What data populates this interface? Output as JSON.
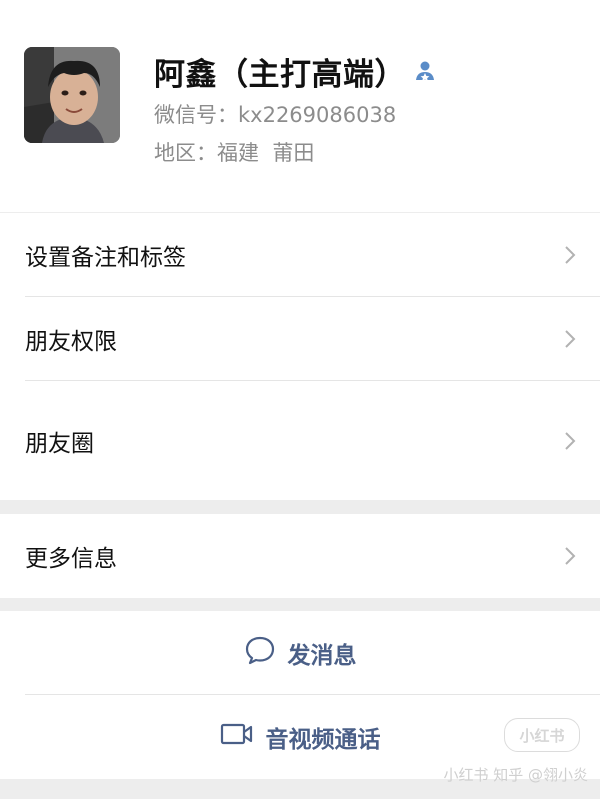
{
  "profile": {
    "name": "阿鑫（主打高端）",
    "wechat_id_label": "微信号：",
    "wechat_id": "kx2269086038",
    "region_label": "地区：",
    "region": "福建  莆田",
    "badge_icon": "user-star-icon",
    "accent_color": "#5a8cc8"
  },
  "menu_primary": [
    {
      "label": "设置备注和标签",
      "icon": "chevron-right-icon"
    },
    {
      "label": "朋友权限",
      "icon": "chevron-right-icon"
    },
    {
      "label": "朋友圈",
      "icon": "chevron-right-icon"
    }
  ],
  "menu_secondary": [
    {
      "label": "更多信息",
      "icon": "chevron-right-icon"
    }
  ],
  "actions": {
    "send_message": {
      "label": "发消息",
      "icon": "chat-bubble-icon"
    },
    "video_call": {
      "label": "音视频通话",
      "icon": "video-camera-icon"
    },
    "color": "#4a5f87"
  },
  "watermark": {
    "badge": "小红书",
    "text": "小红书 知乎 @翎小炎"
  }
}
